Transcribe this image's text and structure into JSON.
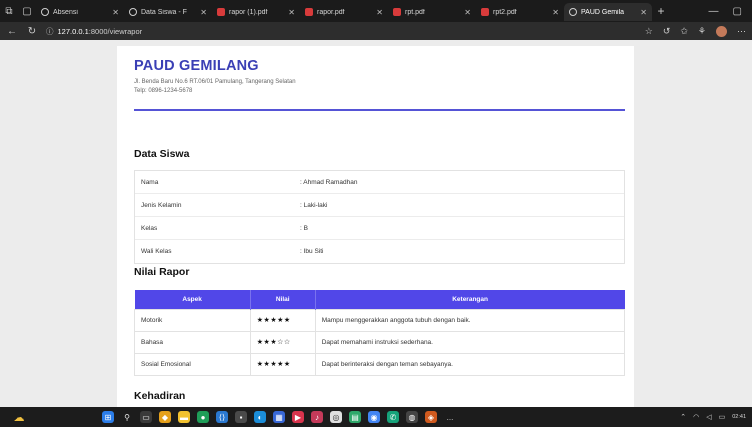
{
  "browser": {
    "tabs": [
      {
        "title": "Absensi",
        "favicon": "globe-icon",
        "active": false
      },
      {
        "title": "Data Siswa - F",
        "favicon": "globe-icon",
        "active": false
      },
      {
        "title": "rapor (1).pdf",
        "favicon": "pdf-icon",
        "active": false
      },
      {
        "title": "rapor.pdf",
        "favicon": "pdf-icon",
        "active": false
      },
      {
        "title": "rpt.pdf",
        "favicon": "pdf-icon",
        "active": false
      },
      {
        "title": "rpt2.pdf",
        "favicon": "pdf-icon",
        "active": false
      },
      {
        "title": "PAUD Gemila",
        "favicon": "globe-icon",
        "active": true
      }
    ],
    "url_host": "127.0.0.1",
    "url_path": ":8000/viewrapor"
  },
  "school": {
    "name": "PAUD GEMILANG",
    "address": "Jl. Benda Baru No.6 RT.06/01 Pamulang, Tangerang Selatan",
    "phone": "Telp: 0896-1234-5678"
  },
  "student_section": {
    "heading": "Data Siswa",
    "rows": [
      {
        "label": "Nama",
        "value": ": Ahmad Ramadhan"
      },
      {
        "label": "Jenis Kelamin",
        "value": ": Laki-laki"
      },
      {
        "label": "Kelas",
        "value": ": B"
      },
      {
        "label": "Wali Kelas",
        "value": ": Ibu Siti"
      }
    ]
  },
  "grades_section": {
    "heading": "Nilai Rapor",
    "columns": [
      "Aspek",
      "Nilai",
      "Keterangan"
    ],
    "rows": [
      {
        "aspect": "Motorik",
        "stars": "★★★★★",
        "rating": 5,
        "note": "Mampu menggerakkan anggota tubuh dengan baik."
      },
      {
        "aspect": "Bahasa",
        "stars": "★★★☆☆",
        "rating": 3,
        "note": "Dapat memahami instruksi sederhana."
      },
      {
        "aspect": "Sosial Emosional",
        "stars": "★★★★★",
        "rating": 5,
        "note": "Dapat berinteraksi dengan teman sebayanya."
      }
    ]
  },
  "attendance_section": {
    "heading": "Kehadiran"
  },
  "taskbar": {
    "time": "02:41",
    "overflow": "..."
  },
  "colors": {
    "brand": "#3a3fb5",
    "table_header": "#5147e8",
    "rule": "#5553d6"
  }
}
